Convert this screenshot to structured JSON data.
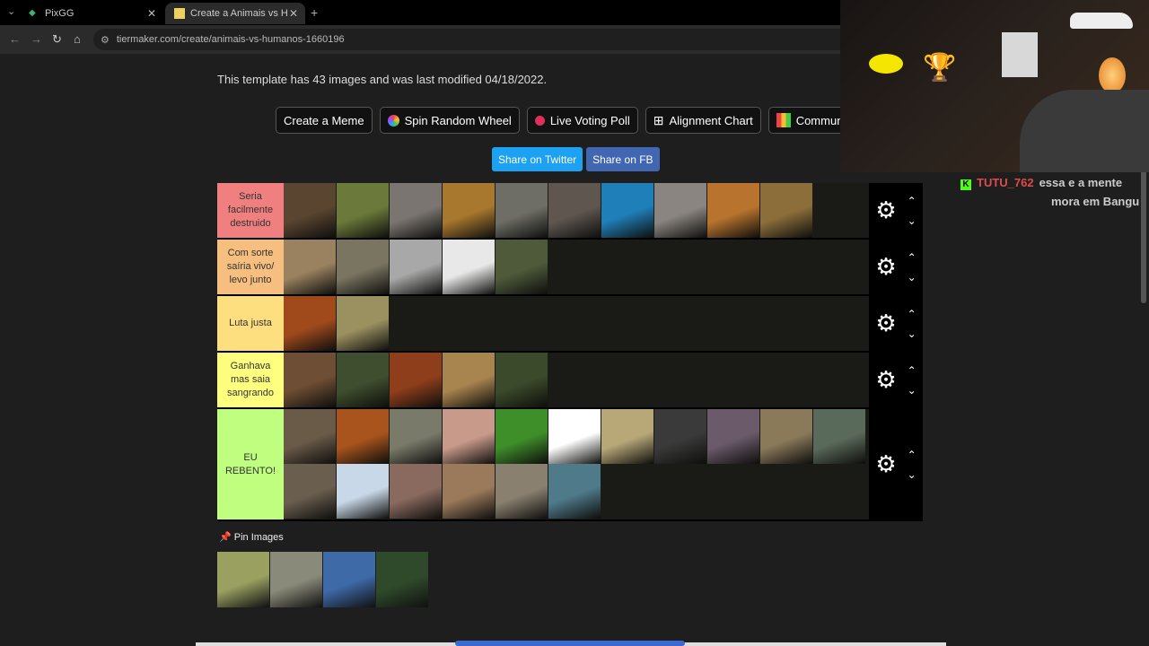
{
  "browser": {
    "tabs": [
      {
        "title": "PixGG",
        "active": false
      },
      {
        "title": "Create a Animais vs Humanos T",
        "active": true
      }
    ],
    "url": "tiermaker.com/create/animais-vs-humanos-1660196"
  },
  "page": {
    "info_text": "This template has 43 images and was last modified 04/18/2022.",
    "buttons": [
      {
        "label": "Create a Meme",
        "icon": ""
      },
      {
        "label": "Spin Random Wheel",
        "icon": "wheel-icon"
      },
      {
        "label": "Live Voting Poll",
        "icon": "record-dot-icon"
      },
      {
        "label": "Alignment Chart",
        "icon": "grid-icon"
      },
      {
        "label": "Community R",
        "icon": "color-grid-icon"
      }
    ],
    "share": {
      "twitter": "Share on Twitter",
      "facebook": "Share on FB"
    }
  },
  "tiers": [
    {
      "label": "Seria facilmente destruido",
      "color": "#f07f7f",
      "images": [
        "bear",
        "moose",
        "hippo",
        "jaguar",
        "elephant",
        "rhino",
        "whale",
        "white-rhino",
        "tiger",
        "lion"
      ]
    },
    {
      "label": "Com sorte saíria vivo/ levo junto",
      "color": "#f7bf7f",
      "images": [
        "hyena",
        "crocodile",
        "wolf",
        "chimpanzee",
        "wild-boar"
      ]
    },
    {
      "label": "Luta justa",
      "color": "#fedf7f",
      "images": [
        "orangutan",
        "giraffe"
      ]
    },
    {
      "label": "Ganhava mas saia sangrando",
      "color": "#fffe7f",
      "images": [
        "pitbull",
        "bald-eagle",
        "maned-wolf",
        "cheetah",
        "tapir"
      ]
    },
    {
      "label": "EU REBENTO!",
      "color": "#bffe7f",
      "images": [
        "capybara",
        "tamarin",
        "ocelot",
        "pig",
        "macaws",
        "penguin",
        "ostrich",
        "goose",
        "river-dolphin",
        "deer",
        "hawk",
        "cat",
        "swan",
        "piranha",
        "owl",
        "zebra",
        "peacock"
      ]
    }
  ],
  "pin": {
    "label": "Pin Images",
    "images": [
      "kangaroo",
      "cobra",
      "horse",
      "panda"
    ]
  },
  "chat": {
    "user": "TUTU_762",
    "message_line1": "essa e a mente",
    "message_line2": "mora em Bangu"
  }
}
